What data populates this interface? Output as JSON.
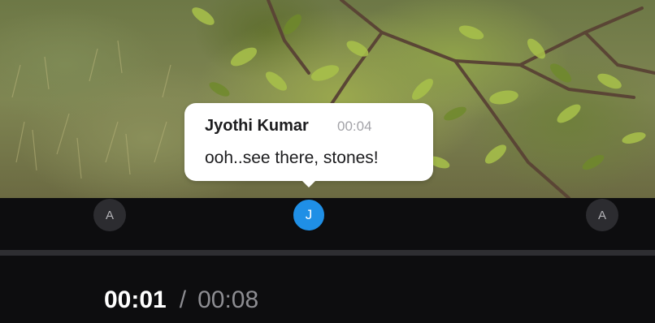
{
  "comment": {
    "author": "Jyothi Kumar",
    "timestamp": "00:04",
    "text": "ooh..see there, stones!"
  },
  "markers": [
    {
      "initial": "A",
      "state": "inactive"
    },
    {
      "initial": "J",
      "state": "active"
    },
    {
      "initial": "A",
      "state": "inactive"
    }
  ],
  "player": {
    "current_time": "00:01",
    "separator": "/",
    "total_time": "00:08",
    "progress_fraction": 0.125
  },
  "colors": {
    "active_marker": "#1f8fe6",
    "inactive_marker": "#2c2c30",
    "background": "#0d0d0f"
  }
}
